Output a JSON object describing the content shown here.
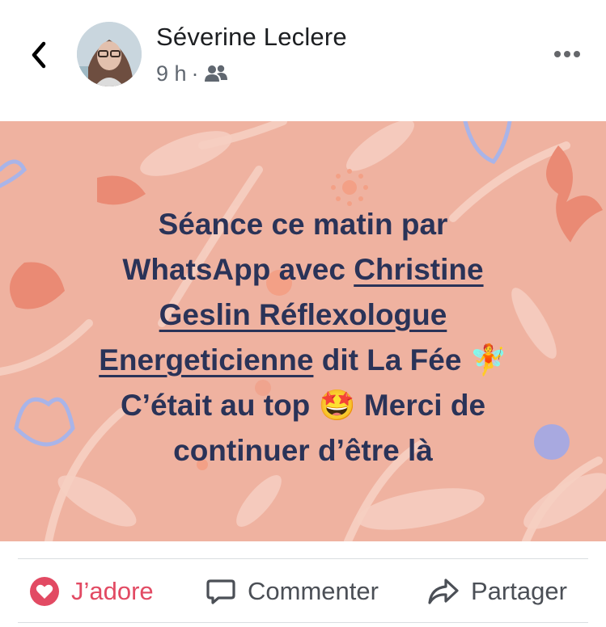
{
  "header": {
    "back_icon": "chevron-left-icon",
    "author_name": "Séverine Leclere",
    "time": "9 h",
    "separator": "·",
    "audience_icon": "friends-icon",
    "more_icon": "more-horizontal-icon"
  },
  "post": {
    "background_color": "#efb2a0",
    "text_color": "#2a3358",
    "lines": {
      "l1": "Séance ce matin par",
      "l2_plain": "WhatsApp avec ",
      "l2_link": "Christine",
      "l3_link": "Geslin Réflexologue",
      "l4_link": "Energeticienne",
      "l4_plain": " dit La Fée ",
      "l4_emoji": "🧚",
      "l5_plain": "C’était au top ",
      "l5_emoji": "🤩",
      "l5_plain2": " Merci de",
      "l6": "continuer d’être là"
    }
  },
  "actions": {
    "love": {
      "label": "J’adore",
      "icon": "heart-icon",
      "color": "#e24a63"
    },
    "comment": {
      "label": "Commenter",
      "icon": "comment-icon"
    },
    "share": {
      "label": "Partager",
      "icon": "share-icon"
    }
  }
}
